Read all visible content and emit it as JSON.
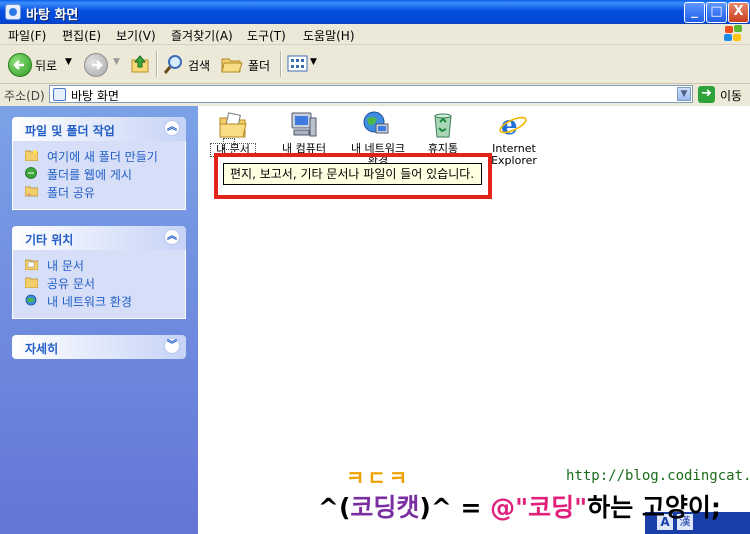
{
  "window": {
    "title": "바탕 화면"
  },
  "title_buttons": {
    "minimize": "_",
    "maximize": "□",
    "close": "X"
  },
  "menu": [
    "파일(F)",
    "편집(E)",
    "보기(V)",
    "즐겨찾기(A)",
    "도구(T)",
    "도움말(H)"
  ],
  "toolbar": {
    "back_label": "뒤로",
    "search_label": "검색",
    "folders_label": "폴더"
  },
  "address": {
    "label": "주소(D)",
    "value": "바탕 화면",
    "go_label": "이동"
  },
  "tasks": {
    "file_folder": {
      "title": "파일 및 폴더 작업",
      "items": [
        "여기에 새 폴더 만들기",
        "폴더를 웹에 게시",
        "폴더 공유"
      ]
    },
    "other_places": {
      "title": "기타 위치",
      "items": [
        "내 문서",
        "공유 문서",
        "내 네트워크 환경"
      ]
    },
    "details": {
      "title": "자세히"
    }
  },
  "desktop_items": [
    {
      "label": "내 문서",
      "icon": "my-documents-icon"
    },
    {
      "label": "내 컴퓨터",
      "icon": "my-computer-icon"
    },
    {
      "label": "내 네트워크 환경",
      "icon": "network-icon"
    },
    {
      "label": "휴지통",
      "icon": "recycle-bin-icon"
    },
    {
      "label": "Internet Explorer",
      "icon": "ie-icon"
    }
  ],
  "tooltip": "편지, 보고서, 기타 문서나 파일이 들어 있습니다.",
  "ime": {
    "mode": "A",
    "hanja": "漢"
  },
  "watermark": {
    "url": "http://blog.codingcat.kr/",
    "jamo": "ㅋㄷㅋ",
    "line_a": "^(",
    "brand": "코딩캣",
    "line_b": ")^ = ",
    "at": "@\"코딩\"",
    "line_c": "하는 고양이;"
  },
  "colors": {
    "highlight_box": "#e2231a",
    "xp_blue": "#0550e0",
    "task_pane": "#6375d6"
  }
}
